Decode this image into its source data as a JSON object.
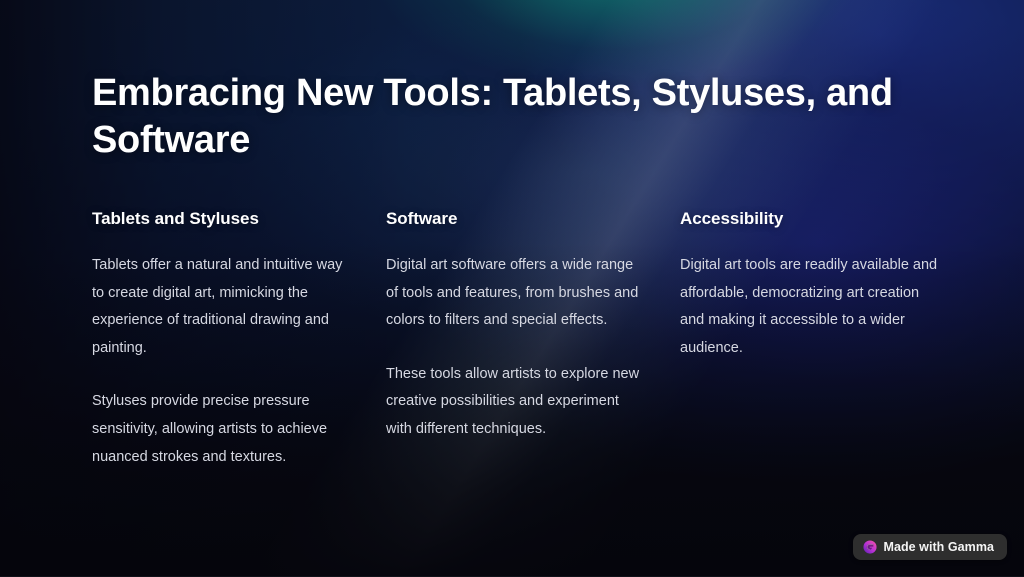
{
  "slide": {
    "title": "Embracing New Tools: Tablets, Styluses, and Software",
    "columns": [
      {
        "heading": "Tablets and Styluses",
        "paragraphs": [
          "Tablets offer a natural and intuitive way to create digital art, mimicking the experience of traditional drawing and painting.",
          "Styluses provide precise pressure sensitivity, allowing artists to achieve nuanced strokes and textures."
        ]
      },
      {
        "heading": "Software",
        "paragraphs": [
          "Digital art software offers a wide range of tools and features, from brushes and colors to filters and special effects.",
          "These tools allow artists to explore new creative possibilities and experiment with different techniques."
        ]
      },
      {
        "heading": "Accessibility",
        "paragraphs": [
          "Digital art tools are readily available and affordable, democratizing art creation and making it accessible to a wider audience."
        ]
      }
    ]
  },
  "badge": {
    "label": "Made with Gamma",
    "icon": "gamma-logo-icon",
    "background_color": "#2e2e2e",
    "text_color": "#f4f4f4",
    "logo_colors": [
      "#e040a0",
      "#b832d6",
      "#7a28c0"
    ]
  },
  "theme": {
    "title_color": "#ffffff",
    "heading_color": "#ffffff",
    "body_color": "#d6d8e2",
    "background_dark": "#07070f",
    "background_navy": "#0d1d3d",
    "background_blue": "#1a2c7a",
    "background_teal": "#127a70"
  }
}
